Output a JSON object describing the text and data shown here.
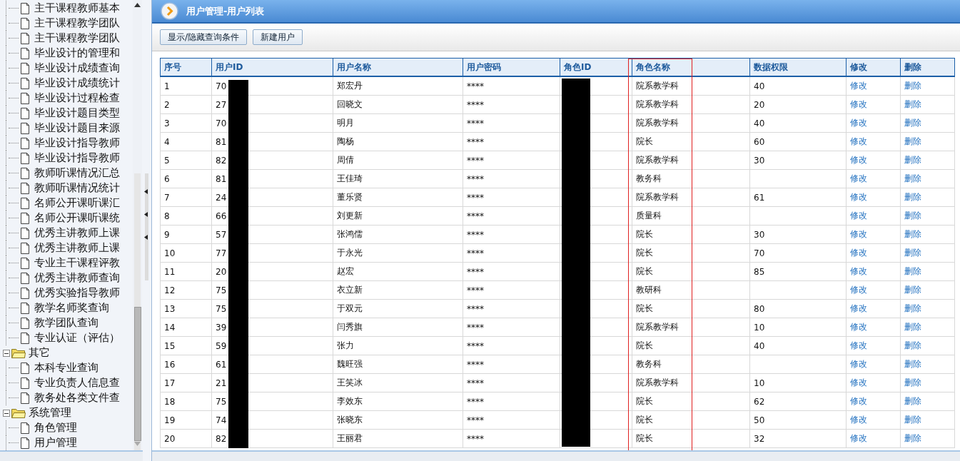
{
  "sidebar": {
    "tree": [
      {
        "children": [
          {
            "label": "主干课程教师基本"
          },
          {
            "label": "主干课程教学团队"
          },
          {
            "label": "主干课程教学团队"
          },
          {
            "label": "毕业设计的管理和"
          },
          {
            "label": "毕业设计成绩查询"
          },
          {
            "label": "毕业设计成绩统计"
          },
          {
            "label": "毕业设计过程检查"
          },
          {
            "label": "毕业设计题目类型"
          },
          {
            "label": "毕业设计题目来源"
          },
          {
            "label": "毕业设计指导教师"
          },
          {
            "label": "毕业设计指导教师"
          },
          {
            "label": "教师听课情况汇总"
          },
          {
            "label": "教师听课情况统计"
          },
          {
            "label": "名师公开课听课汇"
          },
          {
            "label": "名师公开课听课统"
          },
          {
            "label": "优秀主讲教师上课"
          },
          {
            "label": "优秀主讲教师上课"
          },
          {
            "label": "专业主干课程评教"
          },
          {
            "label": "优秀主讲教师查询"
          },
          {
            "label": "优秀实验指导教师"
          },
          {
            "label": "教学名师奖查询"
          },
          {
            "label": "教学团队查询"
          },
          {
            "label": "专业认证（评估）"
          }
        ]
      },
      {
        "label": "其它",
        "expanded": true,
        "children": [
          {
            "label": "本科专业查询"
          },
          {
            "label": "专业负责人信息查"
          },
          {
            "label": "教务处各类文件查"
          }
        ]
      },
      {
        "label": "系统管理",
        "expanded": true,
        "children": [
          {
            "label": "角色管理"
          },
          {
            "label": "用户管理"
          }
        ]
      }
    ]
  },
  "page_header": {
    "title": "用户管理-用户列表"
  },
  "toolbar": {
    "buttons": [
      "显示/隐藏查询条件",
      "新建用户"
    ]
  },
  "table": {
    "columns": [
      "序号",
      "用户ID",
      "用户名称",
      "用户密码",
      "角色ID",
      "角色名称",
      "数据权限",
      "修改",
      "删除"
    ],
    "rows": [
      {
        "no": "1",
        "user_id": "70",
        "name": "郑宏丹",
        "password": "****",
        "role": "院系教学科",
        "permission": "40",
        "edit": "修改",
        "delete": "删除"
      },
      {
        "no": "2",
        "user_id": "27",
        "name": "回晓文",
        "password": "****",
        "role": "院系教学科",
        "permission": "20",
        "edit": "修改",
        "delete": "删除"
      },
      {
        "no": "3",
        "user_id": "70",
        "name": "明月",
        "password": "****",
        "role": "院系教学科",
        "permission": "40",
        "edit": "修改",
        "delete": "删除"
      },
      {
        "no": "4",
        "user_id": "81",
        "name": "陶杨",
        "password": "****",
        "role": "院长",
        "permission": "60",
        "edit": "修改",
        "delete": "删除"
      },
      {
        "no": "5",
        "user_id": "82",
        "name": "周倩",
        "password": "****",
        "role": "院系教学科",
        "permission": "30",
        "edit": "修改",
        "delete": "删除"
      },
      {
        "no": "6",
        "user_id": "81",
        "name": "王佳琦",
        "password": "****",
        "role": "教务科",
        "edit": "修改",
        "delete": "删除"
      },
      {
        "no": "7",
        "user_id": "24",
        "name": "董乐贤",
        "password": "****",
        "role": "院系教学科",
        "permission": "61",
        "edit": "修改",
        "delete": "删除"
      },
      {
        "no": "8",
        "user_id": "66",
        "name": "刘更新",
        "password": "****",
        "role": "质量科",
        "edit": "修改",
        "delete": "删除"
      },
      {
        "no": "9",
        "user_id": "57",
        "name": "张鸿儒",
        "password": "****",
        "role": "院长",
        "permission": "30",
        "edit": "修改",
        "delete": "删除"
      },
      {
        "no": "10",
        "user_id": "77",
        "name": "于永光",
        "password": "****",
        "role": "院长",
        "permission": "70",
        "edit": "修改",
        "delete": "删除"
      },
      {
        "no": "11",
        "user_id": "20",
        "name": "赵宏",
        "password": "****",
        "role": "院长",
        "permission": "85",
        "edit": "修改",
        "delete": "删除"
      },
      {
        "no": "12",
        "user_id": "75",
        "name": "衣立新",
        "password": "****",
        "role": "教研科",
        "edit": "修改",
        "delete": "删除"
      },
      {
        "no": "13",
        "user_id": "75",
        "name": "于双元",
        "password": "****",
        "role": "院长",
        "permission": "80",
        "edit": "修改",
        "delete": "删除"
      },
      {
        "no": "14",
        "user_id": "39",
        "name": "闫秀旗",
        "password": "****",
        "role": "院系教学科",
        "permission": "10",
        "edit": "修改",
        "delete": "删除"
      },
      {
        "no": "15",
        "user_id": "59",
        "name": "张力",
        "password": "****",
        "role": "院长",
        "permission": "40",
        "edit": "修改",
        "delete": "删除"
      },
      {
        "no": "16",
        "user_id": "61",
        "name": "魏旺强",
        "password": "****",
        "role": "教务科",
        "edit": "修改",
        "delete": "删除"
      },
      {
        "no": "17",
        "user_id": "21",
        "name": "王笑冰",
        "password": "****",
        "role": "院系教学科",
        "permission": "10",
        "edit": "修改",
        "delete": "删除"
      },
      {
        "no": "18",
        "user_id": "75",
        "name": "李效东",
        "password": "****",
        "role": "院长",
        "permission": "62",
        "edit": "修改",
        "delete": "删除"
      },
      {
        "no": "19",
        "user_id": "74",
        "name": "张晓东",
        "password": "****",
        "role": "院长",
        "permission": "50",
        "edit": "修改",
        "delete": "删除"
      },
      {
        "no": "20",
        "user_id": "82",
        "name": "王丽君",
        "password": "****",
        "role": "院长",
        "permission": "32",
        "edit": "修改",
        "delete": "删除"
      }
    ]
  }
}
